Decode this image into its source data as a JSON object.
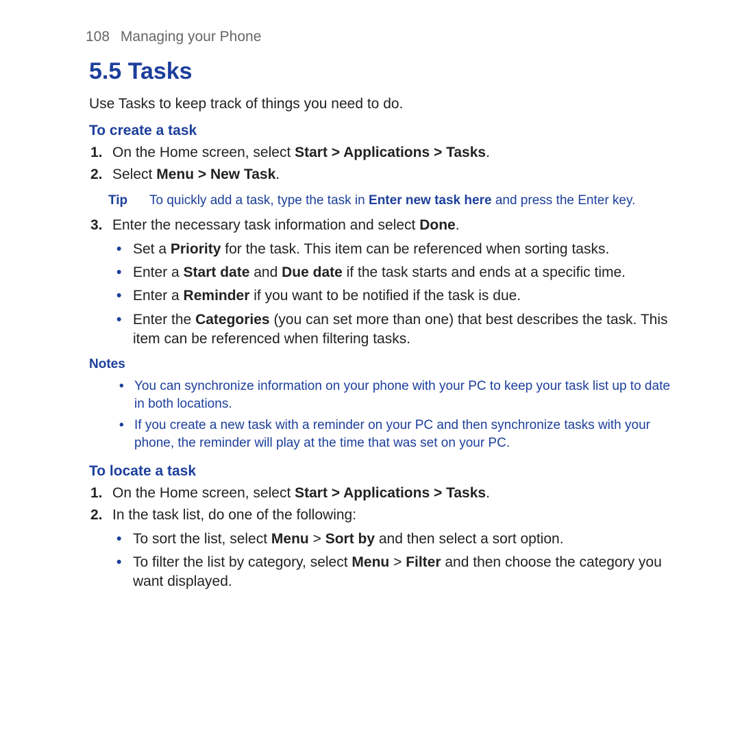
{
  "header": {
    "page_num": "108",
    "chapter": "Managing your Phone"
  },
  "section_title": "5.5  Tasks",
  "intro": "Use Tasks to keep track of things you need to do.",
  "create": {
    "heading": "To create a task",
    "step1": {
      "num": "1.",
      "pre": "On the Home screen, select ",
      "bold": "Start > Applications > Tasks",
      "post": "."
    },
    "step2": {
      "num": "2.",
      "pre": "Select ",
      "bold": "Menu > New Task",
      "post": "."
    },
    "tip_label": "Tip",
    "tip": {
      "pre": "To quickly add a task, type the task in ",
      "bold": "Enter new task here",
      "post": " and press the Enter key."
    },
    "step3": {
      "num": "3.",
      "pre": "Enter the necessary task information and select ",
      "bold": "Done",
      "post": "."
    },
    "sub": {
      "priority": {
        "pre": "Set a ",
        "bold": "Priority",
        "post": " for the task. This item can be referenced when sorting tasks."
      },
      "dates": {
        "pre": "Enter a ",
        "b1": "Start date",
        "mid": " and ",
        "b2": "Due date",
        "post": " if the task starts and ends at a specific time."
      },
      "reminder": {
        "pre": "Enter a ",
        "bold": "Reminder",
        "post": " if you want to be notified if the task is due."
      },
      "categories": {
        "pre": "Enter the ",
        "bold": "Categories",
        "post": " (you can set more than one) that best describes the task. This item can be referenced when filtering tasks."
      }
    }
  },
  "notes_label": "Notes",
  "notes": {
    "n1": "You can synchronize information on your phone with your PC to keep your task list up to date in both locations.",
    "n2": "If you create a new task with a reminder on your PC and then synchronize tasks with your phone, the reminder will play at the time that was set on your PC."
  },
  "locate": {
    "heading": "To locate a task",
    "step1": {
      "num": "1.",
      "pre": "On the Home screen, select ",
      "bold": "Start > Applications > Tasks",
      "post": "."
    },
    "step2": {
      "num": "2.",
      "text": "In the task list, do one of the following:"
    },
    "sub": {
      "sort": {
        "pre": "To sort the list, select ",
        "b1": "Menu",
        "gt1": " > ",
        "b2": "Sort by",
        "post": " and then select a sort option."
      },
      "filter": {
        "pre": "To filter the list by category, select ",
        "b1": "Menu",
        "gt1": " > ",
        "b2": "Filter",
        "post": " and then choose the category you want displayed."
      }
    }
  }
}
